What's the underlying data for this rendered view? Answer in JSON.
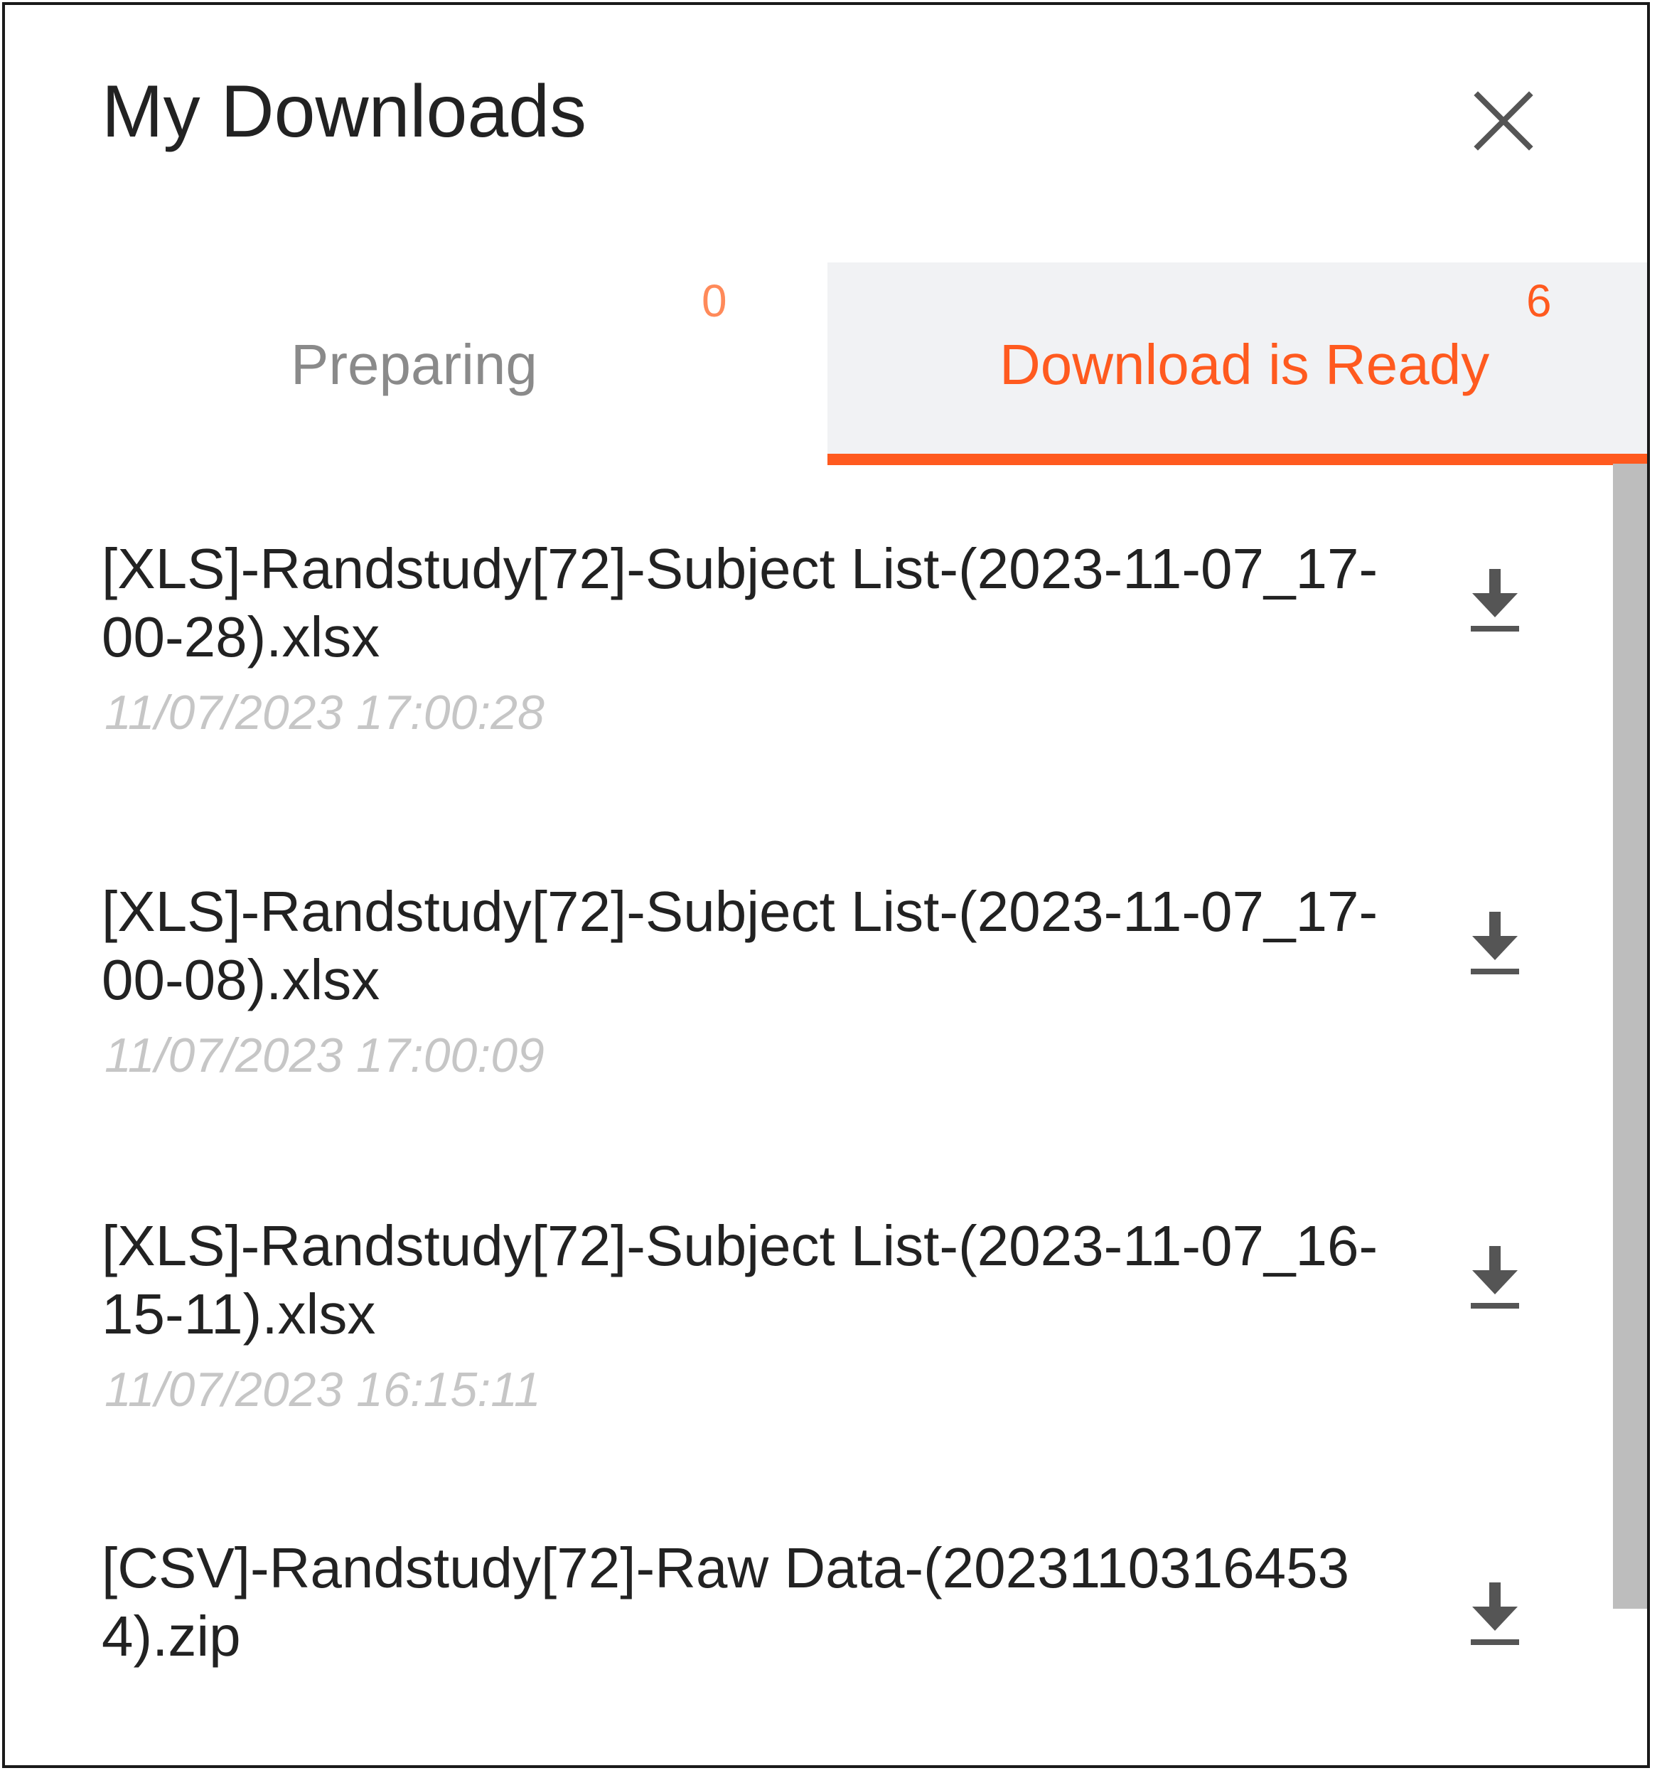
{
  "dialog": {
    "title": "My Downloads",
    "close_icon": "close-icon"
  },
  "tabs": [
    {
      "label": "Preparing",
      "count": "0",
      "active": false
    },
    {
      "label": "Download is Ready",
      "count": "6",
      "active": true
    }
  ],
  "downloads": [
    {
      "name": "[XLS]-Randstudy[72]-Subject List-(2023-11-07_17-00-28).xlsx",
      "time": "11/07/2023 17:00:28",
      "icon": "download-icon"
    },
    {
      "name": "[XLS]-Randstudy[72]-Subject List-(2023-11-07_17-00-08).xlsx",
      "time": "11/07/2023 17:00:09",
      "icon": "download-icon"
    },
    {
      "name": "[XLS]-Randstudy[72]-Subject List-(2023-11-07_16-15-11).xlsx",
      "time": "11/07/2023 16:15:11",
      "icon": "download-icon"
    },
    {
      "name": "[CSV]-Randstudy[72]-Raw Data-(20231103164534).zip",
      "time": "",
      "icon": "download-icon"
    }
  ],
  "colors": {
    "accent": "#ff5a1f",
    "tab_active_bg": "#f1f2f4",
    "text": "#222222",
    "muted": "#c6c6c6"
  }
}
